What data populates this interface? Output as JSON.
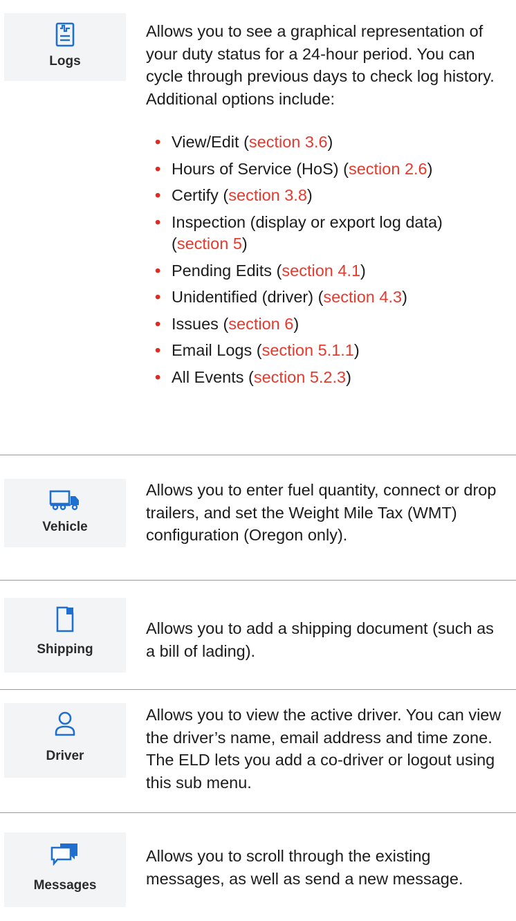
{
  "logs": {
    "tile_label": "Logs",
    "icon": "logs-icon",
    "description": "Allows you to see a graphical representation of your duty status for a 24-hour period. You can cycle through previous days to check log history. Additional options include:",
    "options": [
      {
        "text": "View/Edit (",
        "ref": "section 3.6",
        "suffix": ")"
      },
      {
        "text": "Hours of Service (HoS) (",
        "ref": "section 2.6",
        "suffix": ")"
      },
      {
        "text": "Certify (",
        "ref": "section 3.8",
        "suffix": ")"
      },
      {
        "text": "Inspection (display or export log data) (",
        "ref": "section 5",
        "suffix": ")"
      },
      {
        "text": "Pending Edits (",
        "ref": "section 4.1",
        "suffix": ")"
      },
      {
        "text": "Unidentified (driver) (",
        "ref": "section 4.3",
        "suffix": ")"
      },
      {
        "text": "Issues (",
        "ref": "section 6",
        "suffix": ")"
      },
      {
        "text": "Email Logs (",
        "ref": "section 5.1.1",
        "suffix": ")"
      },
      {
        "text": "All Events (",
        "ref": "section 5.2.3",
        "suffix": ")"
      }
    ]
  },
  "vehicle": {
    "tile_label": "Vehicle",
    "icon": "truck-icon",
    "description": "Allows you to enter fuel quantity, connect or drop trailers, and set the Weight Mile Tax (WMT) configuration (Oregon only)."
  },
  "shipping": {
    "tile_label": "Shipping",
    "icon": "document-icon",
    "description": "Allows you to add a shipping document (such as a bill of lading)."
  },
  "driver": {
    "tile_label": "Driver",
    "icon": "person-icon",
    "description": "Allows you to view the active driver. You can view the driver’s name, email address and time zone. The ELD lets you add a co-driver or logout using this sub menu."
  },
  "messages": {
    "tile_label": "Messages",
    "icon": "chat-bubbles-icon",
    "description": "Allows you to scroll through the existing messages, as well as send a new message."
  },
  "colors": {
    "icon_blue": "#1f6fd1",
    "link_red": "#e53a2e",
    "bullet_red": "#e02b20",
    "tile_bg": "#f3f4f5",
    "divider": "#9a9a9a"
  }
}
